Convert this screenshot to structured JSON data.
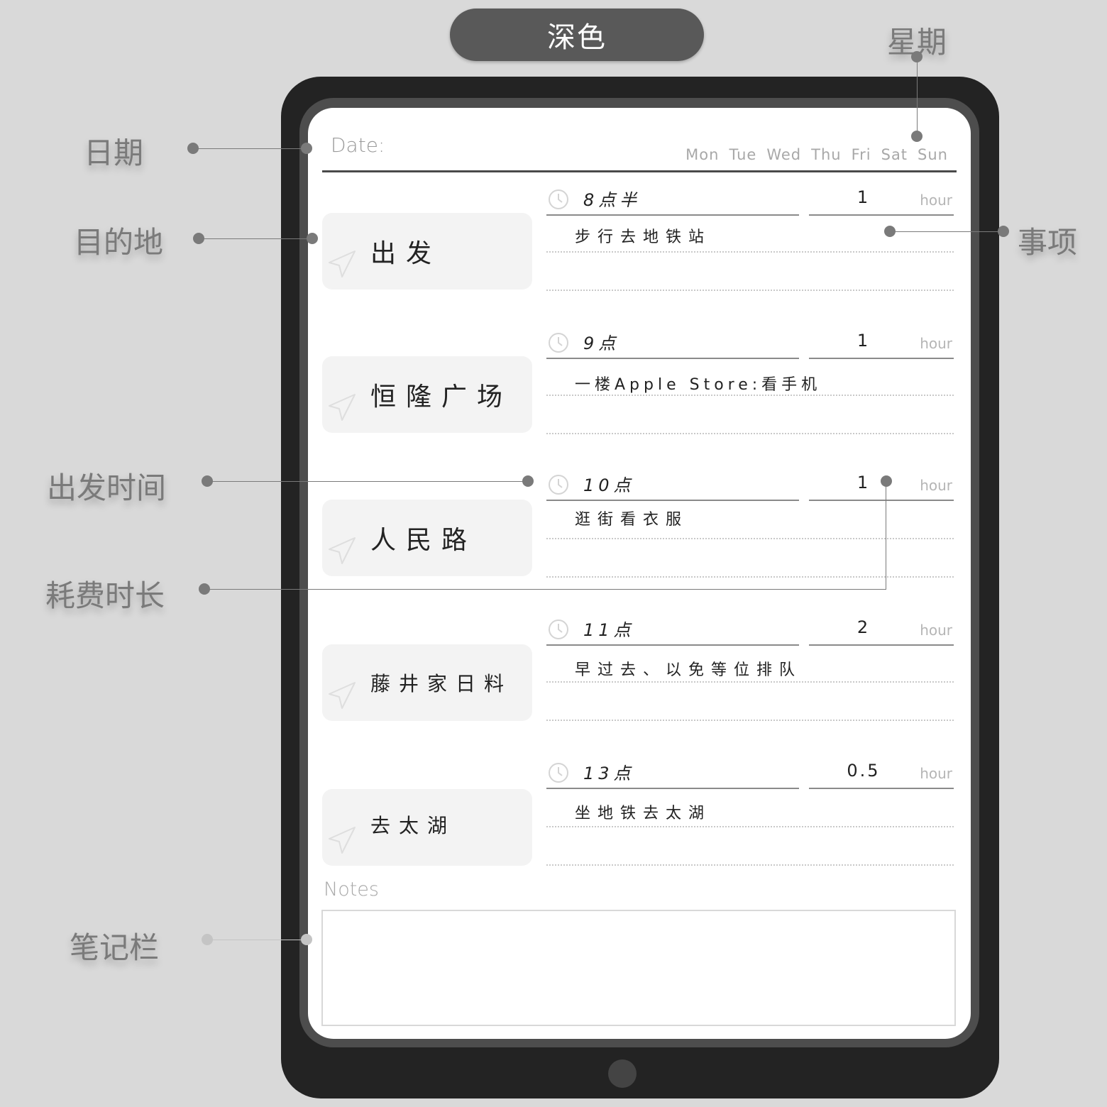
{
  "theme_button": {
    "label": "深色"
  },
  "callouts": {
    "date": "日期",
    "destination": "目的地",
    "depart_time": "出发时间",
    "duration": "耗费时长",
    "notes": "笔记栏",
    "weekday": "星期",
    "task": "事项"
  },
  "planner": {
    "date_label": "Date:",
    "weekdays": [
      "Mon",
      "Tue",
      "Wed",
      "Thu",
      "Fri",
      "Sat",
      "Sun"
    ],
    "hour_unit": "hour",
    "entries": [
      {
        "destination": "出发",
        "time": "8点半",
        "duration": "1",
        "task": "步行去地铁站"
      },
      {
        "destination": "恒隆广场",
        "time": "9点",
        "duration": "1",
        "task": "一楼Apple Store:看手机"
      },
      {
        "destination": "人民路",
        "time": "10点",
        "duration": "1",
        "task": "逛街看衣服"
      },
      {
        "destination": "藤井家日料",
        "time": "11点",
        "duration": "2",
        "task": "早过去、以免等位排队"
      },
      {
        "destination": "去太湖",
        "time": "13点",
        "duration": "0.5",
        "task": "坐地铁去太湖"
      }
    ],
    "notes_label": "Notes",
    "notes_value": ""
  },
  "icons": {
    "clock": "clock-icon",
    "navigation": "navigation-arrow-icon"
  },
  "colors": {
    "background": "#d9d9d9",
    "tablet_body": "#232323",
    "bezel": "#4d4d4d",
    "theme_pill": "#595959",
    "callout_text": "#7a7a7a",
    "card_bg": "#f3f3f3"
  }
}
